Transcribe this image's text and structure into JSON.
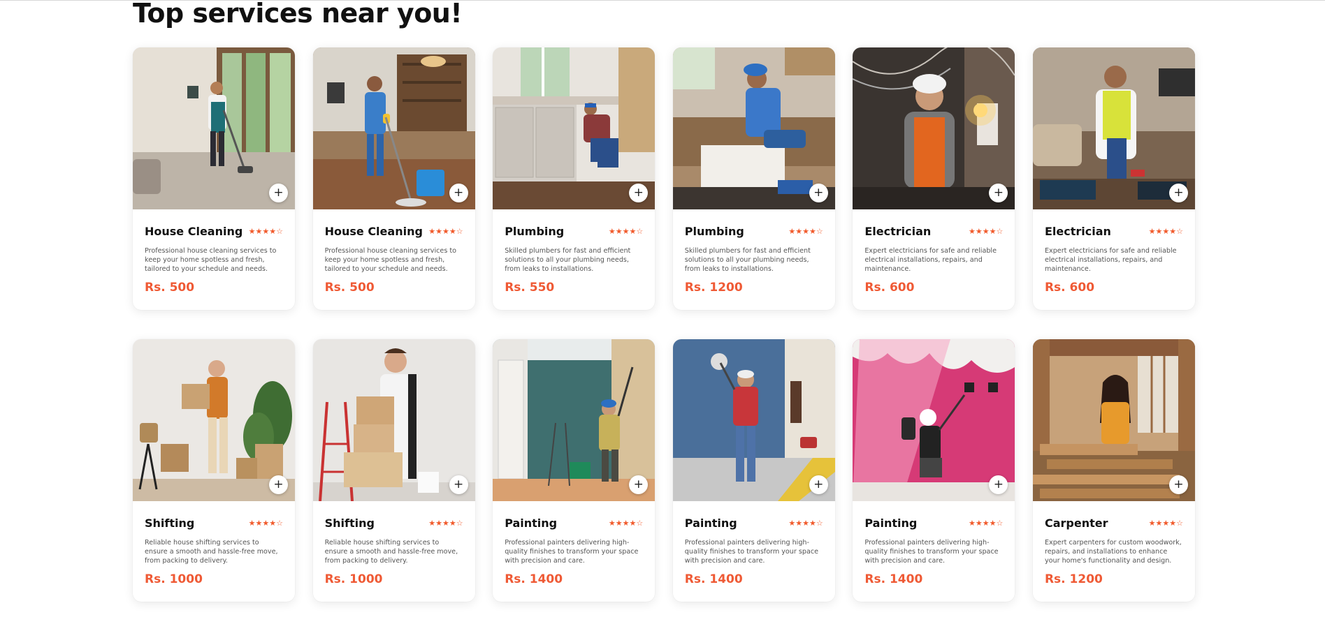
{
  "section": {
    "title": "Top services near you!"
  },
  "rating_icons": {
    "filled": "star-filled-icon",
    "empty": "star-outline-icon"
  },
  "add_icon": "plus-icon",
  "accent_color": "#ef5a35",
  "cards": [
    {
      "title": "House Cleaning",
      "description": "Professional house cleaning services to keep your home spotless and fresh, tailored to your schedule and needs.",
      "price": "Rs. 500",
      "rating": 4,
      "image": "house-cleaning-photo"
    },
    {
      "title": "House Cleaning",
      "description": "Professional house cleaning services to keep your home spotless and fresh, tailored to your schedule and needs.",
      "price": "Rs. 500",
      "rating": 4,
      "image": "house-cleaning-photo"
    },
    {
      "title": "Plumbing",
      "description": "Skilled plumbers for fast and efficient solutions to all your plumbing needs, from leaks to installations.",
      "price": "Rs. 550",
      "rating": 4,
      "image": "plumbing-photo"
    },
    {
      "title": "Plumbing",
      "description": "Skilled plumbers for fast and efficient solutions to all your plumbing needs, from leaks to installations.",
      "price": "Rs. 1200",
      "rating": 4,
      "image": "plumbing-photo"
    },
    {
      "title": "Electrician",
      "description": "Expert electricians for safe and reliable electrical installations, repairs, and maintenance.",
      "price": "Rs. 600",
      "rating": 4,
      "image": "electrician-photo"
    },
    {
      "title": "Electrician",
      "description": "Expert electricians for safe and reliable electrical installations, repairs, and maintenance.",
      "price": "Rs. 600",
      "rating": 4,
      "image": "electrician-photo"
    },
    {
      "title": "Shifting",
      "description": "Reliable house shifting services to ensure a smooth and hassle-free move, from packing to delivery.",
      "price": "Rs. 1000",
      "rating": 4,
      "image": "shifting-photo"
    },
    {
      "title": "Shifting",
      "description": "Reliable house shifting services to ensure a smooth and hassle-free move, from packing to delivery.",
      "price": "Rs. 1000",
      "rating": 4,
      "image": "shifting-photo"
    },
    {
      "title": "Painting",
      "description": "Professional painters delivering high-quality finishes to transform your space with precision and care.",
      "price": "Rs. 1400",
      "rating": 4,
      "image": "painting-photo"
    },
    {
      "title": "Painting",
      "description": "Professional painters delivering high-quality finishes to transform your space with precision and care.",
      "price": "Rs. 1400",
      "rating": 4,
      "image": "painting-photo"
    },
    {
      "title": "Painting",
      "description": "Professional painters delivering high-quality finishes to transform your space with precision and care.",
      "price": "Rs. 1400",
      "rating": 4,
      "image": "painting-photo"
    },
    {
      "title": "Carpenter",
      "description": "Expert carpenters for custom woodwork, repairs, and installations to enhance your home's functionality and design.",
      "price": "Rs. 1200",
      "rating": 4,
      "image": "carpenter-photo"
    }
  ]
}
